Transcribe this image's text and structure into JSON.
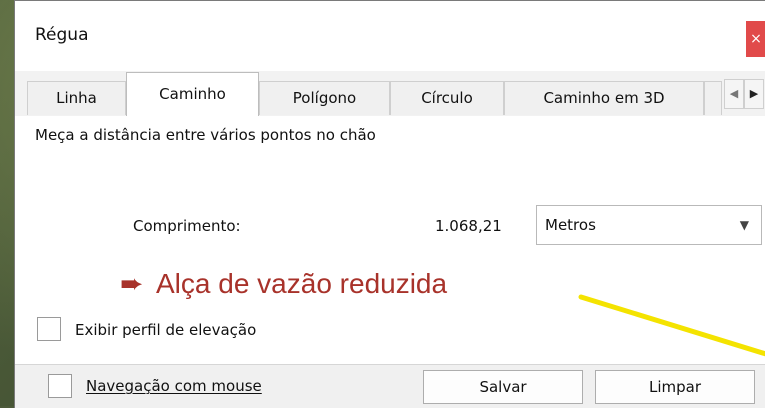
{
  "window": {
    "title": "Régua",
    "close_icon": "close-icon"
  },
  "tabs": [
    {
      "label": "Linha"
    },
    {
      "label": "Caminho"
    },
    {
      "label": "Polígono"
    },
    {
      "label": "Círculo"
    },
    {
      "label": "Caminho em 3D"
    }
  ],
  "active_tab": "Caminho",
  "description": "Meça a distância entre vários pontos no chão",
  "measure": {
    "length_label": "Comprimento:",
    "length_value": "1.068,21",
    "unit": "Metros"
  },
  "annotation": {
    "text": "Alça de vazão reduzida",
    "color": "#a8322a"
  },
  "elevation_profile": {
    "label": "Exibir perfil de elevação",
    "checked": false
  },
  "mouse_navigation": {
    "label": "Navegação com mouse",
    "checked": false
  },
  "buttons": {
    "save": "Salvar",
    "clear": "Limpar"
  }
}
